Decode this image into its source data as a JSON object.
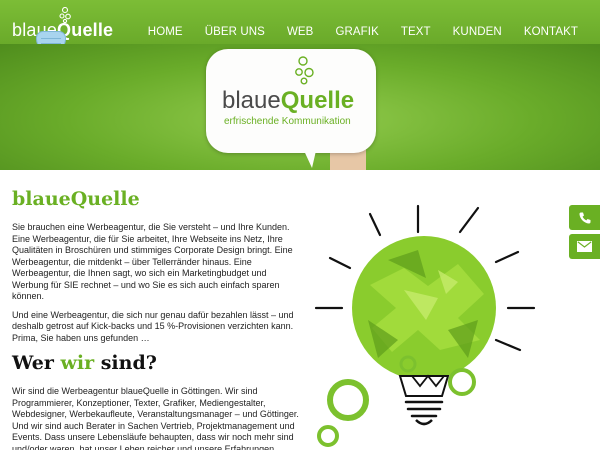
{
  "header": {
    "logo_prefix": "blaue",
    "logo_strong": "Quelle"
  },
  "nav": {
    "items": [
      "HOME",
      "ÜBER UNS",
      "WEB",
      "GRAFIK",
      "TEXT",
      "KUNDEN",
      "KONTAKT"
    ]
  },
  "hero": {
    "brand_prefix": "blaue",
    "brand_strong": "Quelle",
    "tagline": "erfrischende Kommunikation"
  },
  "main": {
    "title": "blaueQuelle",
    "para1": "Sie brauchen eine Werbeagentur, die Sie versteht – und Ihre Kunden. Eine Werbeagentur, die für Sie arbeitet, Ihre Webseite ins Netz, Ihre Qualitäten in Broschüren und stimmiges Corporate Design bringt. Eine Werbeagentur, die mitdenkt – über Tellerränder hinaus. Eine Werbeagentur, die Ihnen sagt, wo sich ein Marketingbudget und Werbung für SIE rechnet – und wo Sie es sich auch einfach sparen können.",
    "para2": "Und eine Werbeagentur, die sich nur genau dafür bezahlen lässt – und deshalb getrost auf Kick-backs und 15 %-Provisionen verzichten kann. Prima, Sie haben uns gefunden …",
    "heading_pre": "Wer ",
    "heading_hl": "wir",
    "heading_post": " sind?",
    "para3": "Wir sind die Werbeagentur blaueQuelle in Göttingen. Wir sind Programmierer, Konzeptioner, Texter, Grafiker, Mediengestalter, Webdesigner, Werbekaufleute, Veranstaltungsmanager – und Göttinger. Und wir sind auch Berater in Sachen Vertrieb, Projektmanagement und Events. Dass unsere Lebensläufe behaupten, dass wir noch mehr sind und/oder waren, hat unser Leben reicher und unsere Erfahrungen"
  },
  "side": {
    "phone_icon": "phone-icon",
    "mail_icon": "mail-icon"
  },
  "colors": {
    "brand_green": "#6ab023",
    "header_green": "#74b731"
  }
}
